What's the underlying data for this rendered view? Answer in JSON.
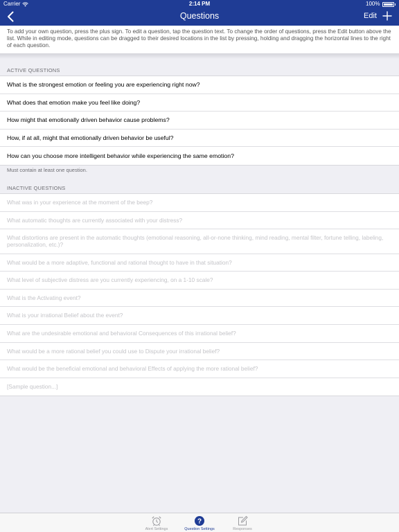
{
  "status_bar": {
    "carrier": "Carrier",
    "time": "2:14 PM",
    "battery": "100%"
  },
  "nav": {
    "title": "Questions",
    "edit_label": "Edit"
  },
  "instructions": "To add your own question, press the plus sign. To edit a question, tap the question text. To change the order of questions, press the Edit button above the list. While in editing mode, questions can be dragged to their desired locations in the list by pressing, holding and dragging the horizontal lines to the right of each question.",
  "active": {
    "header": "ACTIVE QUESTIONS",
    "items": [
      "What is the strongest emotion or feeling you are experiencing right now?",
      "What does that emotion make you feel like doing?",
      "How might that emotionally driven behavior cause problems?",
      "How, if at all, might that emotionally driven behavior be useful?",
      "How can you choose more intelligent behavior while experiencing the same emotion?"
    ],
    "footer": "Must contain at least one question."
  },
  "inactive": {
    "header": "INACTIVE QUESTIONS",
    "items": [
      "What was in your experience at the moment of the beep?",
      "What automatic thoughts are currently associated with your distress?",
      "What distortions are present in the automatic thoughts (emotional reasoning, all-or-none thinking, mind reading, mental filter, fortune telling, labeling, personalization, etc.)?",
      "What would be a more adaptive, functional and rational thought to have in that situation?",
      "What level of subjective distress are you currently experiencing, on a 1-10 scale?",
      "What is the Activating event?",
      "What is your irrational Belief about the event?",
      "What are the undesirable emotional and behavioral Consequences of this irrational belief?",
      "What would be a more rational belief you could use to Dispute your irrational belief?",
      "What would be the beneficial emotional and behavioral Effects of applying the more rational belief?",
      "[Sample question...]"
    ]
  },
  "tabs": [
    {
      "label": "Alert Settings",
      "icon": "alarm-clock-icon",
      "selected": false
    },
    {
      "label": "Question Settings",
      "icon": "question-icon",
      "selected": true
    },
    {
      "label": "Responses",
      "icon": "compose-icon",
      "selected": false
    }
  ],
  "colors": {
    "nav_bar": "#1f3c95",
    "accent": "#1f3c95",
    "inactive_text": "#c4c4c8"
  }
}
